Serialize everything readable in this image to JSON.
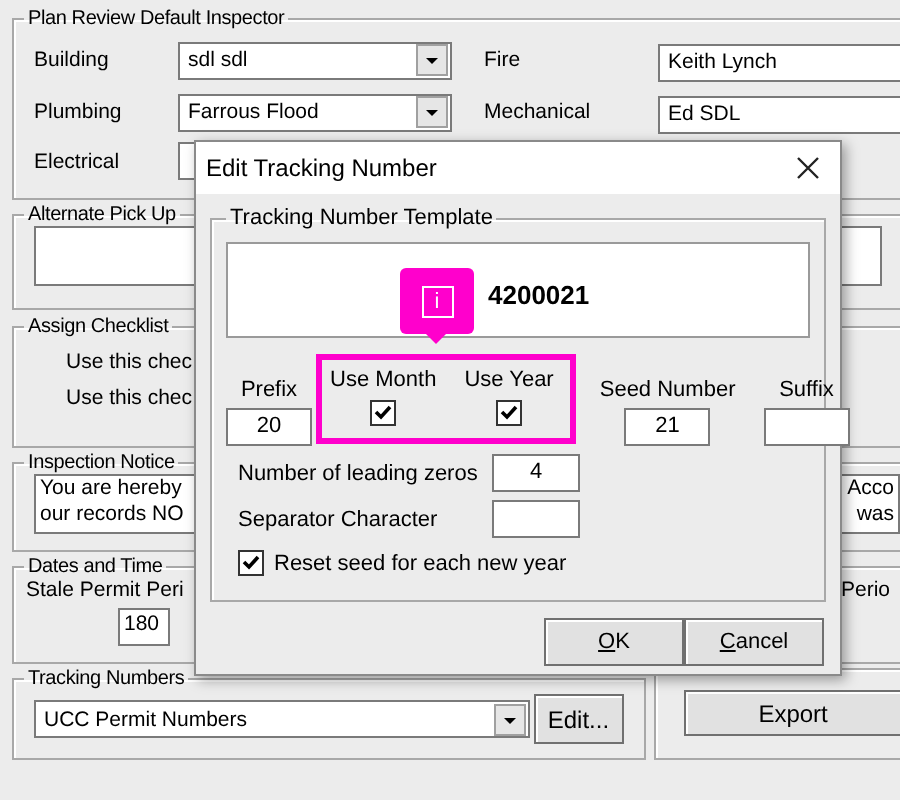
{
  "plan_review": {
    "title": "Plan Review Default Inspector",
    "fields": [
      {
        "label": "Building",
        "value": "sdl sdl",
        "kind": "dropdown"
      },
      {
        "label": "Fire",
        "value": "Keith Lynch",
        "kind": "text"
      },
      {
        "label": "Plumbing",
        "value": "Farrous Flood",
        "kind": "dropdown"
      },
      {
        "label": "Mechanical",
        "value": "Ed SDL",
        "kind": "text"
      },
      {
        "label": "Electrical",
        "kind": "text"
      }
    ]
  },
  "alternate_pickup": {
    "title": "Alternate Pick Up"
  },
  "assign_checklist": {
    "title": "Assign Checklist",
    "rows": [
      "Use this chec",
      "Use this chec"
    ]
  },
  "inspection_notice": {
    "title": "Inspection Notice",
    "lines_left": [
      "You are hereby",
      "our records NO"
    ],
    "lines_right": [
      "Acco",
      "was"
    ]
  },
  "dates": {
    "title": "Dates and Time",
    "stale_label": "Stale Permit Peri",
    "stale_value": "180",
    "right_label": "Perio"
  },
  "tracking_numbers": {
    "title": "Tracking Numbers",
    "selection": "UCC Permit Numbers",
    "edit_button": "Edit..."
  },
  "export_button": "Export",
  "dialog": {
    "title": "Edit Tracking Number",
    "template": {
      "title": "Tracking Number Template",
      "preview": "4200021",
      "prefix": {
        "label": "Prefix",
        "value": "20"
      },
      "use_month": {
        "label": "Use Month",
        "checked": true
      },
      "use_year": {
        "label": "Use Year",
        "checked": true
      },
      "seed": {
        "label": "Seed Number",
        "value": "21"
      },
      "suffix": {
        "label": "Suffix"
      },
      "leading_zeros": {
        "label": "Number of leading zeros",
        "value": "4"
      },
      "separator": {
        "label": "Separator Character"
      },
      "reset_seed": {
        "label": "Reset seed for each new year",
        "checked": true
      }
    },
    "buttons": [
      "OK",
      "Cancel"
    ]
  },
  "callout": {
    "text": "i"
  }
}
